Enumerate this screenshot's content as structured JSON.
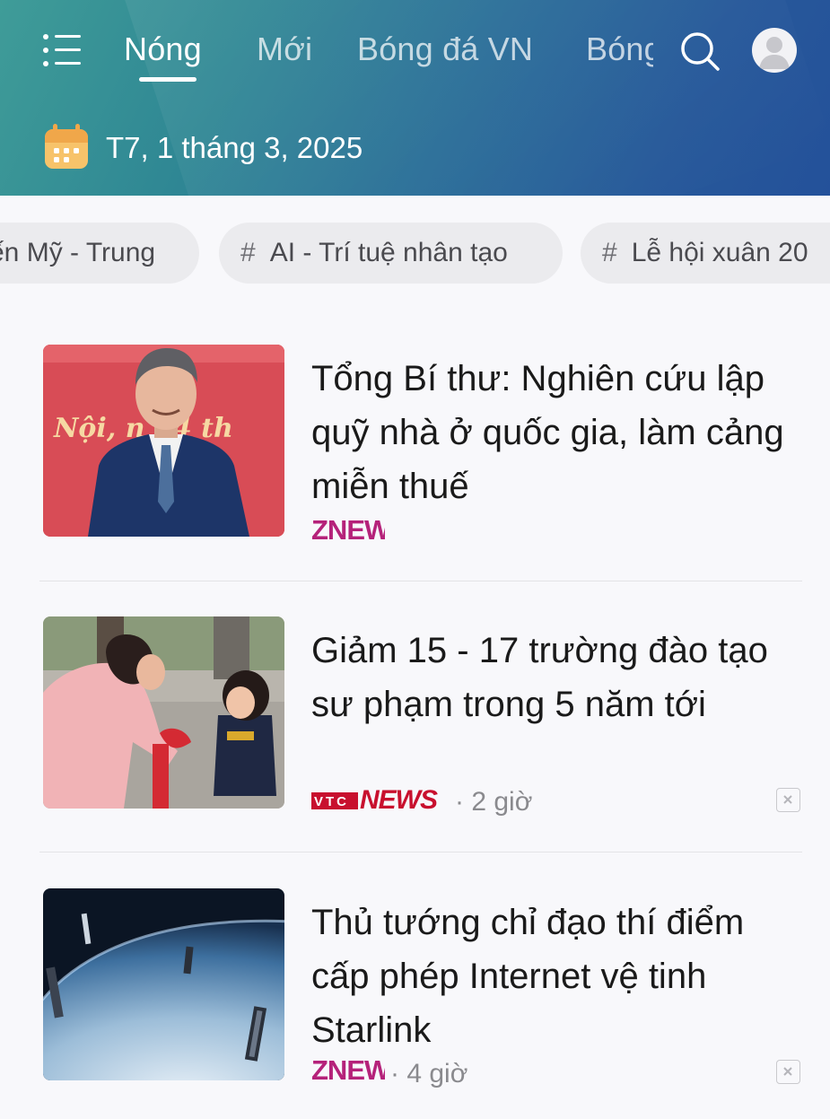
{
  "header": {
    "tabs": [
      {
        "label": "Nóng",
        "active": true
      },
      {
        "label": "Mới",
        "active": false
      },
      {
        "label": "Bóng đá VN",
        "active": false
      },
      {
        "label": "Bóng",
        "active": false
      }
    ],
    "date": "T7, 1 tháng 3, 2025",
    "icons": {
      "menu": "menu-icon",
      "search": "search-icon",
      "avatar": "user-avatar-icon",
      "calendar": "calendar-icon"
    }
  },
  "topics": [
    {
      "hash": "#",
      "label": "ến Mỹ - Trung"
    },
    {
      "hash": "#",
      "label": "AI - Trí tuệ nhân tạo"
    },
    {
      "hash": "#",
      "label": "Lễ hội xuân 20"
    }
  ],
  "articles": [
    {
      "title": "Tổng Bí thư: Nghiên cứu lập quỹ nhà ở quốc gia, làm cảng miễn thuế",
      "source": "ZNEWS",
      "time": "",
      "thumb_text": "Nội, n    24 th"
    },
    {
      "title": "Giảm 15 - 17 trường đào tạo sư phạm trong 5 năm tới",
      "source": "VTCNEWS",
      "source_parts": {
        "small": "VTC",
        "big": "NEWS"
      },
      "time": "· 2 giờ"
    },
    {
      "title": "Thủ tướng chỉ đạo thí điểm cấp phép Internet vệ tinh Starlink",
      "source": "ZNEWS",
      "time": "· 4 giờ"
    }
  ],
  "colors": {
    "header_start": "#3f9c98",
    "header_end": "#24519a",
    "zing_z": "#b5227a",
    "vtc_red": "#c8102e",
    "text": "#1a1a1a",
    "meta": "#8a8a8e",
    "chip_bg": "#ebebee"
  }
}
